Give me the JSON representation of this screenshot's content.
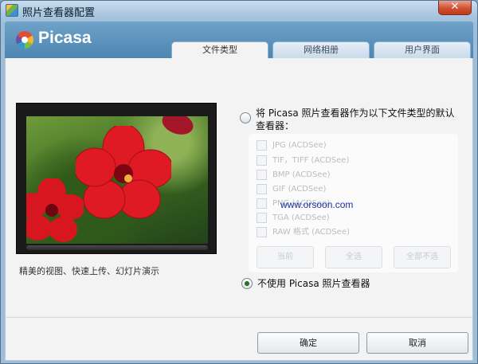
{
  "window": {
    "title": "照片查看器配置",
    "close_label": "✕"
  },
  "header": {
    "brand": "Picasa",
    "tabs": [
      {
        "label": "文件类型",
        "active": true
      },
      {
        "label": "网络相册",
        "active": false
      },
      {
        "label": "用户界面",
        "active": false
      }
    ]
  },
  "preview": {
    "caption": "精美的视图、快速上传、幻灯片演示"
  },
  "options": {
    "use_picasa_label": "将 Picasa 照片查看器作为以下文件类型的默认查看器：",
    "use_picasa_checked": false,
    "no_picasa_label": "不使用 Picasa 照片查看器",
    "no_picasa_checked": true
  },
  "filetypes": [
    {
      "label": "JPG (ACDSee)",
      "checked": false
    },
    {
      "label": "TIF，TIFF (ACDSee)",
      "checked": false
    },
    {
      "label": "BMP (ACDSee)",
      "checked": false
    },
    {
      "label": "GIF (ACDSee)",
      "checked": false
    },
    {
      "label": "PNG (ACDSee)",
      "checked": false
    },
    {
      "label": "TGA (ACDSee)",
      "checked": false
    },
    {
      "label": "RAW 格式 (ACDSee)",
      "checked": false
    }
  ],
  "filetype_buttons": {
    "current": "当前",
    "select_all": "全选",
    "select_none": "全部不选"
  },
  "watermark": "www.orsoon.com",
  "footer": {
    "ok_label": "确定",
    "cancel_label": "取消"
  },
  "colors": {
    "header_blue": "#4d86b2",
    "title_bar": "#a9c6df",
    "selected_radio": "#2e7f2a",
    "watermark": "#1a2fa6"
  }
}
